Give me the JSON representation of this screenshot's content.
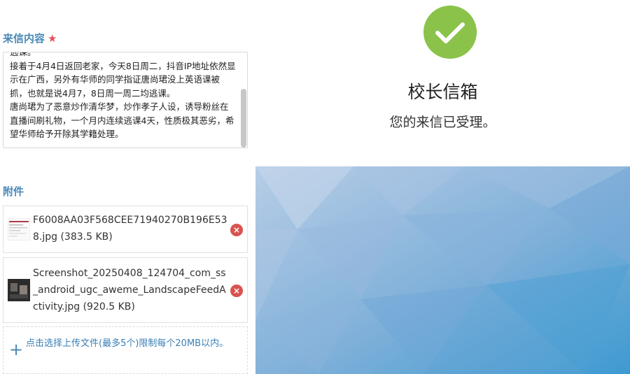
{
  "form": {
    "content_label": "来信内容",
    "required_mark": "★",
    "letter_text": "逃课。\n接着于4月4日返回老家，今天8日周二，抖音IP地址依然显示在广西，另外有华师的同学指证唐尚珺没上英语课被抓，也就是说4月7，8日周一周二均逃课。\n唐尚珺为了恶意炒作清华梦，炒作孝子人设，诱导粉丝在直播间刷礼物，一个月内连续逃课4天，性质极其恶劣，希望华师给予开除其学籍处理。",
    "attachments_label": "附件",
    "attachments": [
      {
        "name": "F6008AA03F568CEE71940270B196E538.jpg (383.5 KB)",
        "thumb": "document-thumbnail"
      },
      {
        "name": "Screenshot_20250408_124704_com_ss_android_ugc_aweme_LandscapeFeedActivity.jpg (920.5 KB)",
        "thumb": "dark-photo-thumbnail"
      }
    ],
    "upload_text": "点击选择上传文件(最多5个)限制每个20MB以内。"
  },
  "result": {
    "title": "校长信箱",
    "message": "您的来信已受理。",
    "status_icon": "check-circle-icon",
    "accent": "#8bc34a"
  },
  "colors": {
    "label_blue": "#4a8ab8",
    "required_red": "#e0505a",
    "remove_red": "#d9534f",
    "panel_blue_light": "#b7cde6",
    "panel_blue_dark": "#3d9ad1"
  }
}
